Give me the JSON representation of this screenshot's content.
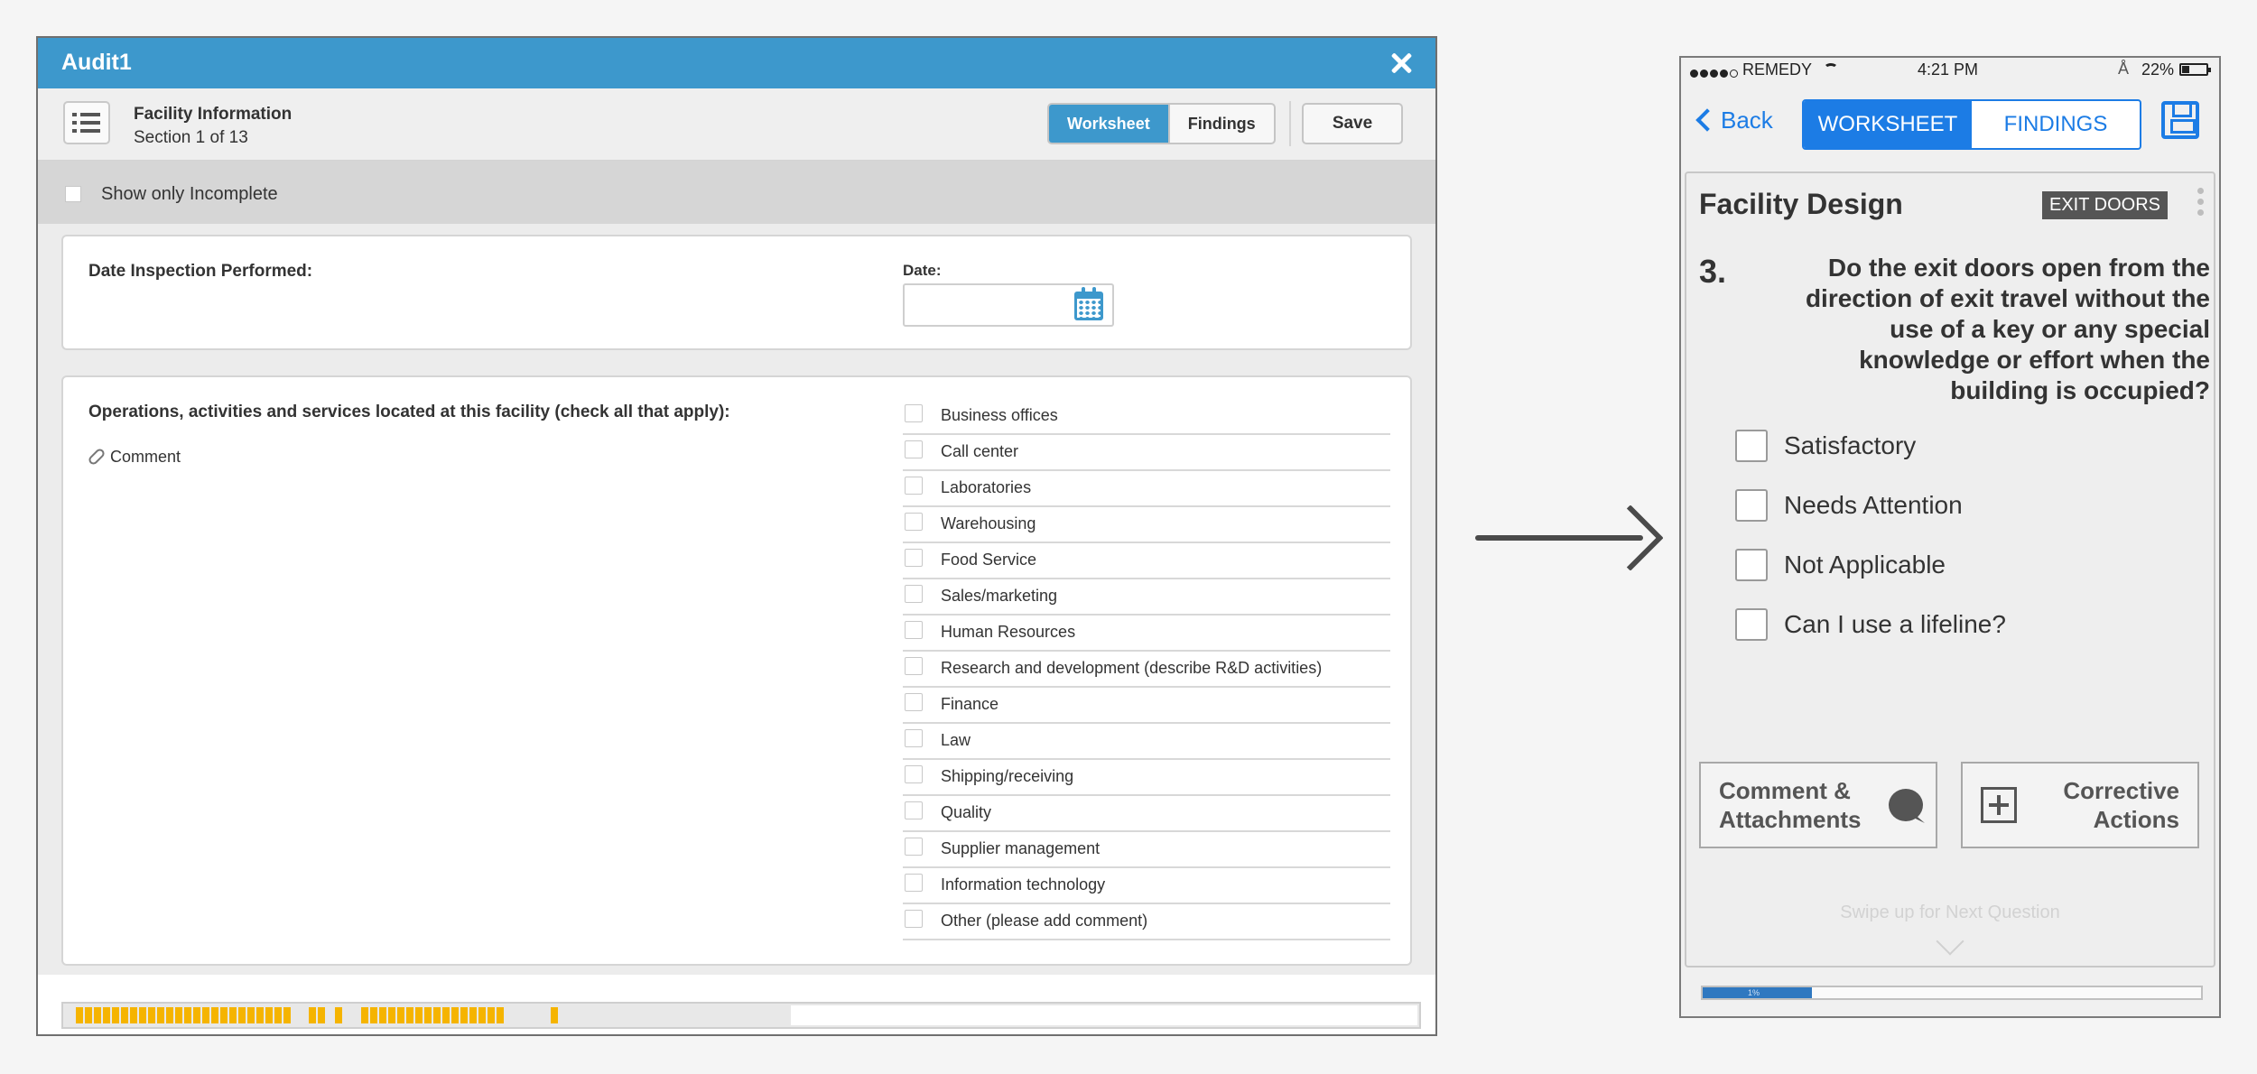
{
  "desktop": {
    "window_title": "Audit1",
    "section_title": "Facility Information",
    "section_sub": "Section 1 of 13",
    "tabs": [
      {
        "label": "Worksheet",
        "active": true
      },
      {
        "label": "Findings",
        "active": false
      }
    ],
    "save_label": "Save",
    "filter_label": "Show only Incomplete",
    "date_question": "Date Inspection Performed:",
    "date_label": "Date:",
    "date_value": "",
    "ops_question": "Operations, activities and services located at this facility (check all that apply):",
    "comment_label": "Comment",
    "options": [
      "Business offices",
      "Call center",
      "Laboratories",
      "Warehousing",
      "Food Service",
      "Sales/marketing",
      "Human Resources",
      "Research and development (describe R&D activities)",
      "Finance",
      "Law",
      "Shipping/receiving",
      "Quality",
      "Supplier management",
      "Information technology",
      "Other (please add comment)"
    ],
    "progress_color": "#f5b400"
  },
  "phone": {
    "status": {
      "carrier": "REMEDY",
      "time": "4:21 PM",
      "battery": "22%"
    },
    "back_label": "Back",
    "tabs": [
      {
        "label": "WORKSHEET",
        "active": true
      },
      {
        "label": "FINDINGS",
        "active": false
      }
    ],
    "section_title": "Facility Design",
    "tag": "EXIT DOORS",
    "question_number": "3.",
    "question_text": "Do the exit doors open from the direction of exit travel without the use of a key or any special knowledge or effort when the building is occupied?",
    "options": [
      "Satisfactory",
      "Needs Attention",
      "Not Applicable",
      "Can I use a lifeline?"
    ],
    "comment_button_line1": "Comment &",
    "comment_button_line2": "Attachments",
    "corrective_button_line1": "Corrective",
    "corrective_button_line2": "Actions",
    "swipe_hint": "Swipe up for Next Question",
    "progress_label": "1%",
    "progress_fraction": 0.22,
    "accent_color": "#1c7ce5"
  }
}
